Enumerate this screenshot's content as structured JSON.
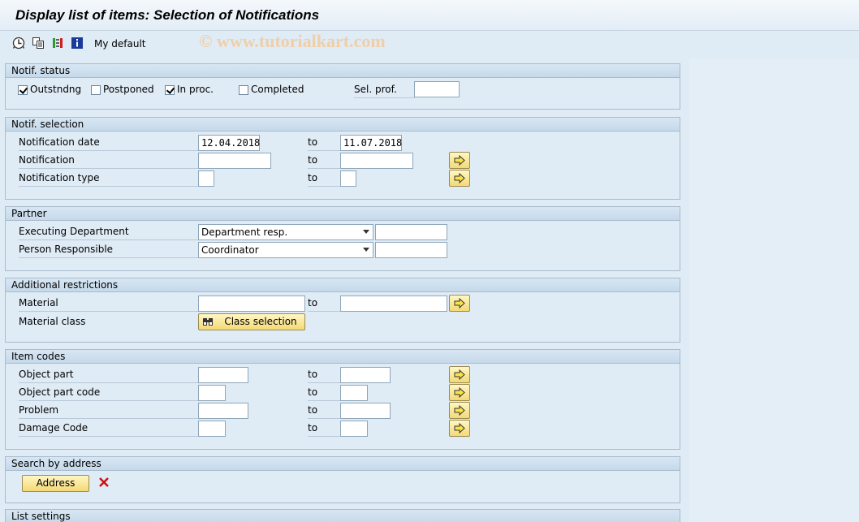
{
  "window": {
    "title": "Display list of items: Selection of Notifications",
    "watermark": "© www.tutorialkart.com"
  },
  "toolbar": {
    "variant_label": "My default",
    "icons": [
      "execute-icon",
      "variants-icon",
      "selection-options-icon",
      "info-icon"
    ]
  },
  "status": {
    "header": "Notif. status",
    "outstanding": {
      "label": "Outstndng",
      "checked": true
    },
    "postponed": {
      "label": "Postponed",
      "checked": false
    },
    "inproc": {
      "label": "In proc.",
      "checked": true
    },
    "completed": {
      "label": "Completed",
      "checked": false
    },
    "selprof_label": "Sel. prof.",
    "selprof_value": ""
  },
  "selection": {
    "header": "Notif. selection",
    "to_label": "to",
    "date_label": "Notification date",
    "date_from": "12.04.2018",
    "date_to": "11.07.2018",
    "notif_label": "Notification",
    "notif_from": "",
    "notif_to": "",
    "type_label": "Notification type",
    "type_from": "",
    "type_to": ""
  },
  "partner": {
    "header": "Partner",
    "exec_label": "Executing Department",
    "exec_select": "Department resp.",
    "exec_value": "",
    "person_label": "Person Responsible",
    "person_select": "Coordinator",
    "person_value": ""
  },
  "additional": {
    "header": "Additional restrictions",
    "material_label": "Material",
    "material_from": "",
    "material_to": "",
    "class_label": "Material class",
    "class_button": "Class selection"
  },
  "itemcodes": {
    "header": "Item codes",
    "objpart_label": "Object part",
    "objpartcode_label": "Object part code",
    "problem_label": "Problem",
    "damage_label": "Damage Code"
  },
  "address": {
    "header": "Search by address",
    "button": "Address"
  },
  "list": {
    "header": "List settings"
  },
  "colors": {
    "bg": "#dfebf5",
    "button": "#f4d975",
    "delete": "#cc1111"
  }
}
